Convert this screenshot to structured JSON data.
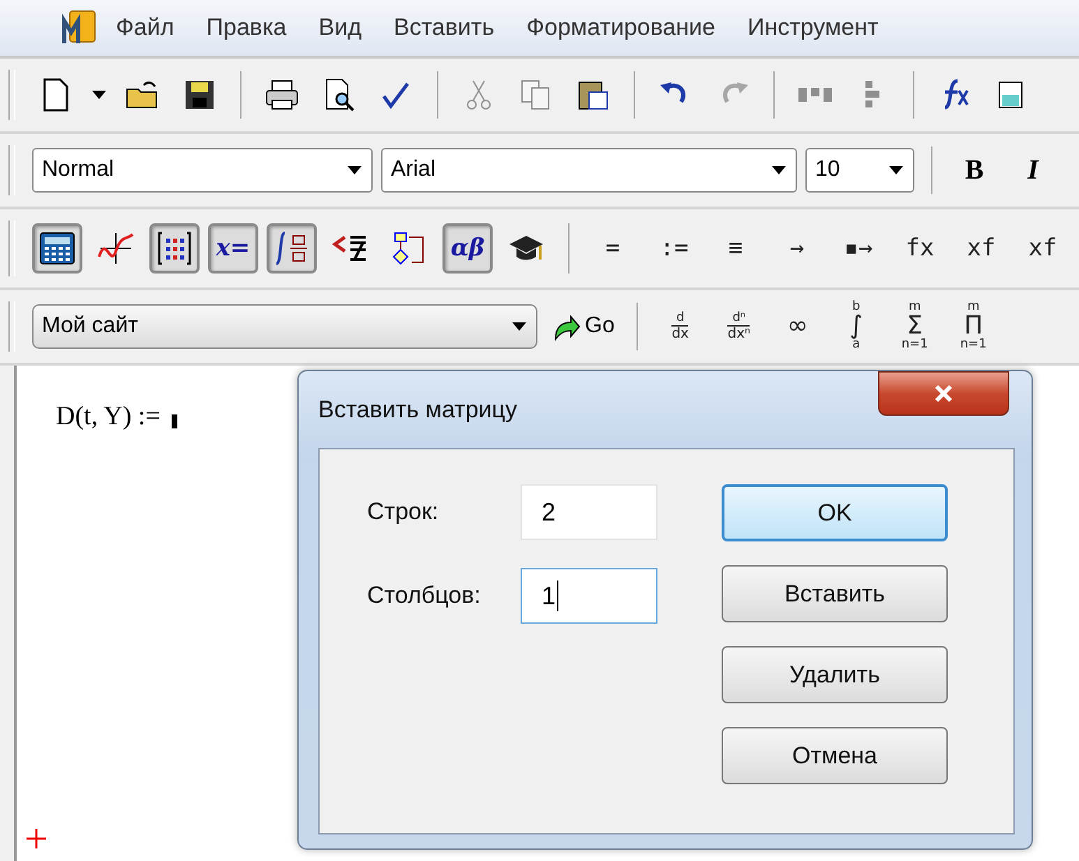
{
  "menu": [
    {
      "label": "Файл"
    },
    {
      "label": "Правка"
    },
    {
      "label": "Вид"
    },
    {
      "label": "Вставить"
    },
    {
      "label": "Форматирование"
    },
    {
      "label": "Инструмент"
    }
  ],
  "standard_toolbar": [
    {
      "disabled": false
    },
    {
      "disabled": false
    },
    {
      "disabled": false
    },
    {
      "disabled": false
    },
    {
      "disabled": false
    },
    {
      "disabled": false
    },
    {
      "disabled": false
    },
    {
      "disabled": true
    },
    {
      "disabled": true
    },
    {
      "disabled": false
    },
    {
      "disabled": false
    },
    {
      "disabled": true
    },
    {
      "disabled": true
    },
    {
      "disabled": true
    },
    {
      "disabled": false
    },
    {
      "disabled": false
    }
  ],
  "format_toolbar": {
    "style": "Normal",
    "font": "Arial",
    "size": "10",
    "bold": "B",
    "italic": "I"
  },
  "math_toolbar": [
    {
      "kind": "icon",
      "selected": true
    },
    {
      "kind": "icon",
      "selected": false
    },
    {
      "kind": "icon",
      "selected": true
    },
    {
      "kind": "text",
      "label": "x=",
      "selected": true
    },
    {
      "kind": "icon",
      "selected": true
    },
    {
      "kind": "icon",
      "selected": false
    },
    {
      "kind": "icon",
      "selected": false
    },
    {
      "kind": "text",
      "label": "αβ",
      "selected": true
    },
    {
      "kind": "icon",
      "selected": false
    }
  ],
  "evaluation_operators": [
    "=",
    ":=",
    "≡",
    "→",
    "▪→",
    "fx",
    "xf",
    "xf"
  ],
  "resources_toolbar": {
    "site": "Мой сайт",
    "go": "Go"
  },
  "calculus_palette": [
    {
      "kind": "fraction",
      "top": "d",
      "bottom": "dx"
    },
    {
      "kind": "fraction",
      "top": "dⁿ",
      "bottom": "dxⁿ"
    },
    {
      "kind": "symbol",
      "symbol": "∞"
    },
    {
      "kind": "limits",
      "symbol": "∫",
      "top": "b",
      "bottom": "a"
    },
    {
      "kind": "limits",
      "symbol": "Σ",
      "top": "m",
      "bottom": "n=1"
    },
    {
      "kind": "limits",
      "symbol": "Π",
      "top": "m",
      "bottom": "n=1"
    }
  ],
  "worksheet": {
    "expression": "D(t, Y) :="
  },
  "dialog": {
    "title": "Вставить матрицу",
    "fields": [
      {
        "label": "Строк:",
        "value": "2",
        "focused": false
      },
      {
        "label": "Столбцов:",
        "value": "1",
        "focused": true
      }
    ],
    "buttons": [
      {
        "label": "OK",
        "default": true
      },
      {
        "label": "Вставить",
        "default": false
      },
      {
        "label": "Удалить",
        "default": false
      },
      {
        "label": "Отмена",
        "default": false
      }
    ]
  }
}
